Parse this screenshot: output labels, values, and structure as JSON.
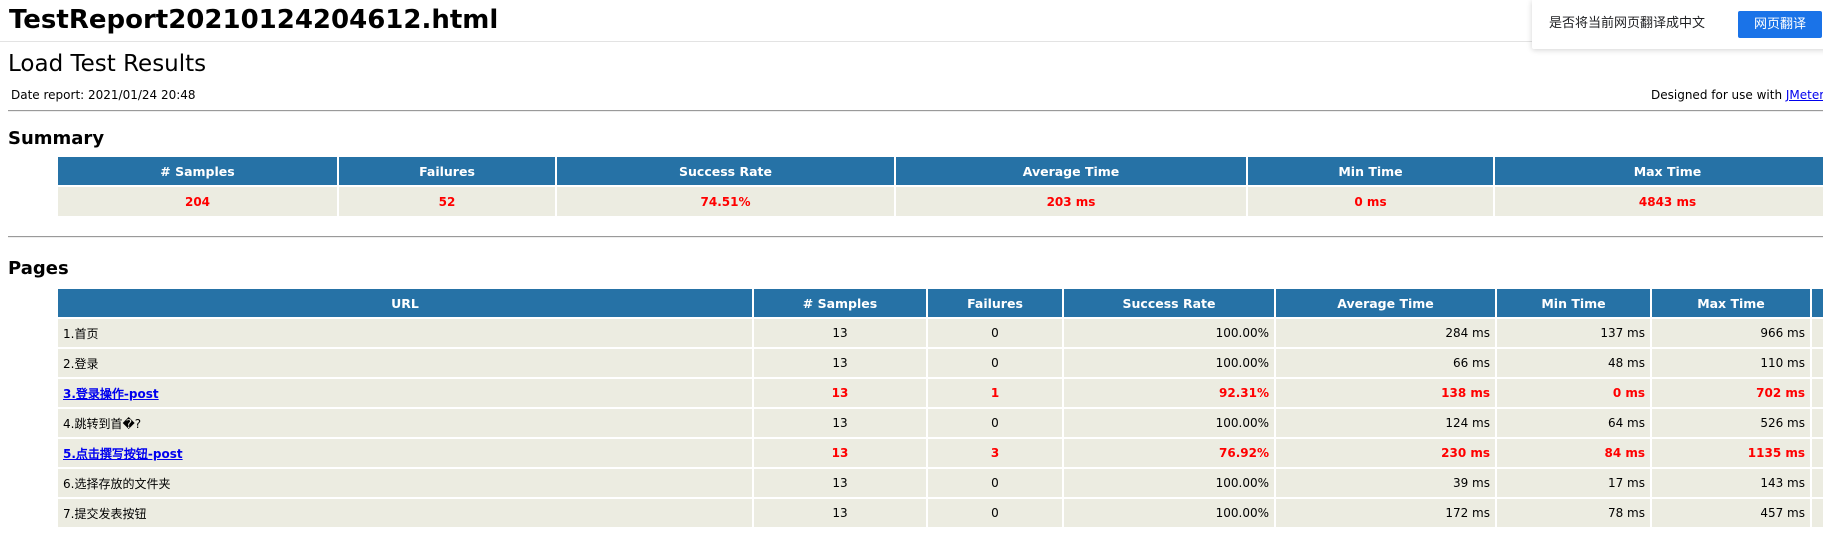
{
  "file_title": "TestReport20210124204612.html",
  "translate_popup": {
    "prompt": "是否将当前网页翻译成中文",
    "button_label": "网页翻译"
  },
  "report": {
    "title": "Load Test Results",
    "date_report": "Date report: 2021/01/24 20:48",
    "designed_for_prefix": "Designed for use with ",
    "designed_for_link": "JMeter"
  },
  "summary": {
    "heading": "Summary",
    "headers": [
      "# Samples",
      "Failures",
      "Success Rate",
      "Average Time",
      "Min Time",
      "Max Time"
    ],
    "values": [
      "204",
      "52",
      "74.51%",
      "203 ms",
      "0 ms",
      "4843 ms"
    ]
  },
  "pages": {
    "heading": "Pages",
    "headers": [
      "URL",
      "# Samples",
      "Failures",
      "Success Rate",
      "Average Time",
      "Min Time",
      "Max Time"
    ],
    "rows": [
      {
        "url": "1.首页",
        "samples": "13",
        "failures": "0",
        "success_rate": "100.00%",
        "avg": "284 ms",
        "min": "137 ms",
        "max": "966 ms",
        "failed": false
      },
      {
        "url": "2.登录",
        "samples": "13",
        "failures": "0",
        "success_rate": "100.00%",
        "avg": "66 ms",
        "min": "48 ms",
        "max": "110 ms",
        "failed": false
      },
      {
        "url": "3.登录操作-post",
        "samples": "13",
        "failures": "1",
        "success_rate": "92.31%",
        "avg": "138 ms",
        "min": "0 ms",
        "max": "702 ms",
        "failed": true
      },
      {
        "url": "4.跳转到首�?",
        "samples": "13",
        "failures": "0",
        "success_rate": "100.00%",
        "avg": "124 ms",
        "min": "64 ms",
        "max": "526 ms",
        "failed": false
      },
      {
        "url": "5.点击撰写按钮-post",
        "samples": "13",
        "failures": "3",
        "success_rate": "76.92%",
        "avg": "230 ms",
        "min": "84 ms",
        "max": "1135 ms",
        "failed": true
      },
      {
        "url": "6.选择存放的文件夹",
        "samples": "13",
        "failures": "0",
        "success_rate": "100.00%",
        "avg": "39 ms",
        "min": "17 ms",
        "max": "143 ms",
        "failed": false
      },
      {
        "url": "7.提交发表按钮",
        "samples": "13",
        "failures": "0",
        "success_rate": "100.00%",
        "avg": "172 ms",
        "min": "78 ms",
        "max": "457 ms",
        "failed": false
      }
    ]
  },
  "colors": {
    "header_bg": "#2672a6",
    "cell_bg": "#ecece1",
    "failure_text": "#ff0000",
    "link": "#0000ee",
    "translate_button": "#1a73e8"
  }
}
